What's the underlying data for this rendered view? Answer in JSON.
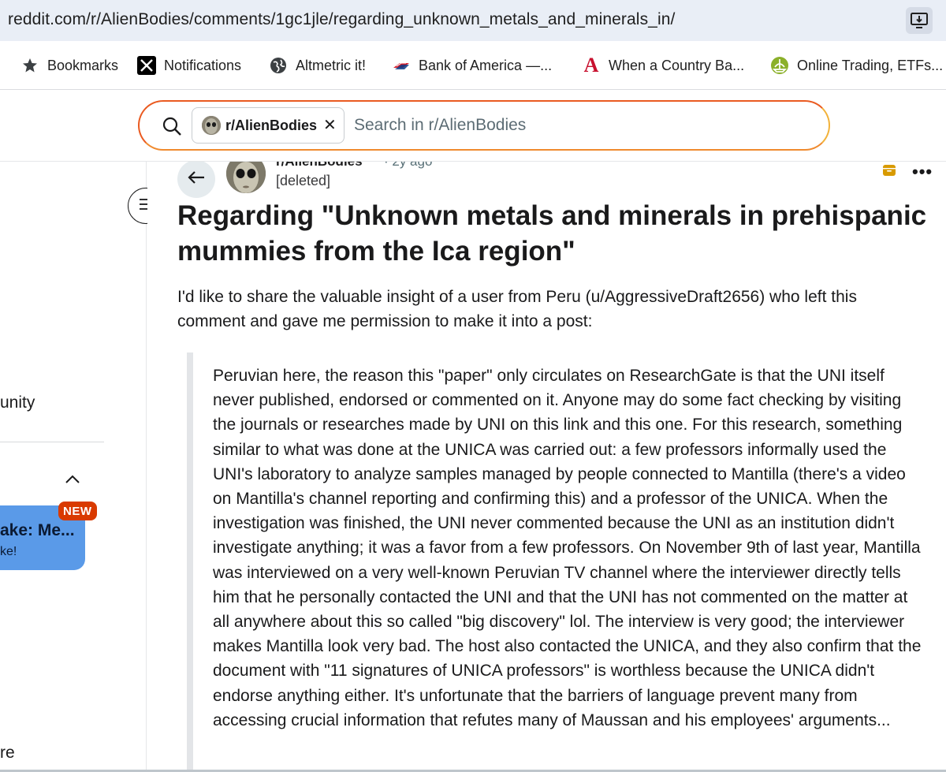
{
  "browser": {
    "url": "reddit.com/r/AlienBodies/comments/1gc1jle/regarding_unknown_metals_and_minerals_in/",
    "install_icon": "install-app-icon"
  },
  "bookmarks": [
    {
      "label": "Bookmarks",
      "icon": "star-icon"
    },
    {
      "label": "Notifications",
      "icon": "x-logo-icon"
    },
    {
      "label": "Altmetric it!",
      "icon": "globe-icon"
    },
    {
      "label": "Bank of America —...",
      "icon": "flag-icon"
    },
    {
      "label": "When a Country Ba...",
      "icon": "letter-a-icon"
    },
    {
      "label": "Online Trading, ETFs...",
      "icon": "ship-icon"
    }
  ],
  "search": {
    "community_chip": "r/AlienBodies",
    "chip_close": "✕",
    "placeholder": "Search in r/AlienBodies"
  },
  "sidebar": {
    "fragment_community": "unity",
    "promo_title": "ake: Me...",
    "promo_sub": "ke!",
    "new_badge": "NEW",
    "fragment_bottom": "re"
  },
  "post": {
    "subreddit": "r/AlienBodies",
    "time": "· 2y ago",
    "author": "[deleted]",
    "title": "Regarding \"Unknown metals and minerals in prehispanic mummies from the Ica region\"",
    "intro": "I'd like to share the valuable insight of a user from Peru (u/AggressiveDraft2656) who left this comment and gave me permission to make it into a post:",
    "quote": "Peruvian here, the reason this \"paper\" only circulates on ResearchGate is that the UNI itself never published, endorsed or commented on it. Anyone may do some fact checking by visiting the journals or researches made by UNI on this link and this one. For this research, something similar to what was done at the UNICA was carried out: a few professors informally used the UNI's laboratory to analyze samples managed by people connected to Mantilla (there's a video on Mantilla's channel reporting and confirming this) and a professor of the UNICA. When the investigation was finished, the UNI never commented because the UNI as an institution didn't investigate anything; it was a favor from a few professors. On November 9th of last year, Mantilla was interviewed on a very well-known Peruvian TV channel where the interviewer directly tells him that he personally contacted the UNI and that the UNI has not commented on the matter at all anywhere about this so called \"big discovery\" lol. The interview is very good; the interviewer makes Mantilla look very bad. The host also contacted the UNICA, and they also confirm that the document with \"11 signatures of UNICA professors\" is worthless because the UNICA didn't endorse anything either. It's unfortunate that the barriers of language prevent many from accessing crucial information that refutes many of Maussan and his employees' arguments...",
    "more_icon": "•••"
  },
  "colors": {
    "search_border": "#ea5a20",
    "new_badge": "#d93a00",
    "promo": "#5a9ae8"
  }
}
